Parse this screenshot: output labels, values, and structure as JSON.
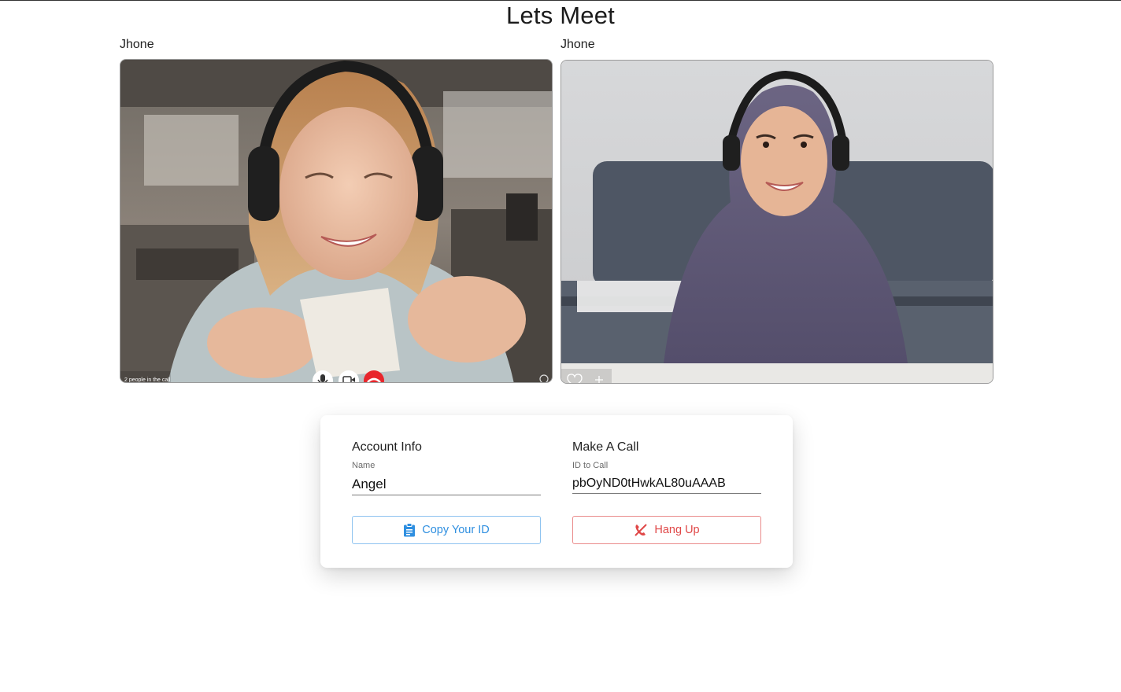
{
  "page": {
    "title": "Lets Meet"
  },
  "videos": [
    {
      "label": "Jhone",
      "overlay_text": "2 people in the call"
    },
    {
      "label": "Jhone"
    }
  ],
  "account": {
    "title": "Account Info",
    "name_label": "Name",
    "name_value": "Angel",
    "copy_button": "Copy Your ID"
  },
  "call": {
    "title": "Make A Call",
    "id_label": "ID to Call",
    "id_value": "pbOyND0tHwkAL80uAAAB",
    "hangup_button": "Hang Up"
  },
  "colors": {
    "copy_accent": "#2f8fe0",
    "hangup_accent": "#e04848",
    "end_call_red": "#e8262c"
  },
  "icons": [
    "clipboard-icon",
    "phone-disabled-icon",
    "mic-icon",
    "camera-icon",
    "end-call-icon",
    "heart-icon",
    "plus-icon"
  ]
}
